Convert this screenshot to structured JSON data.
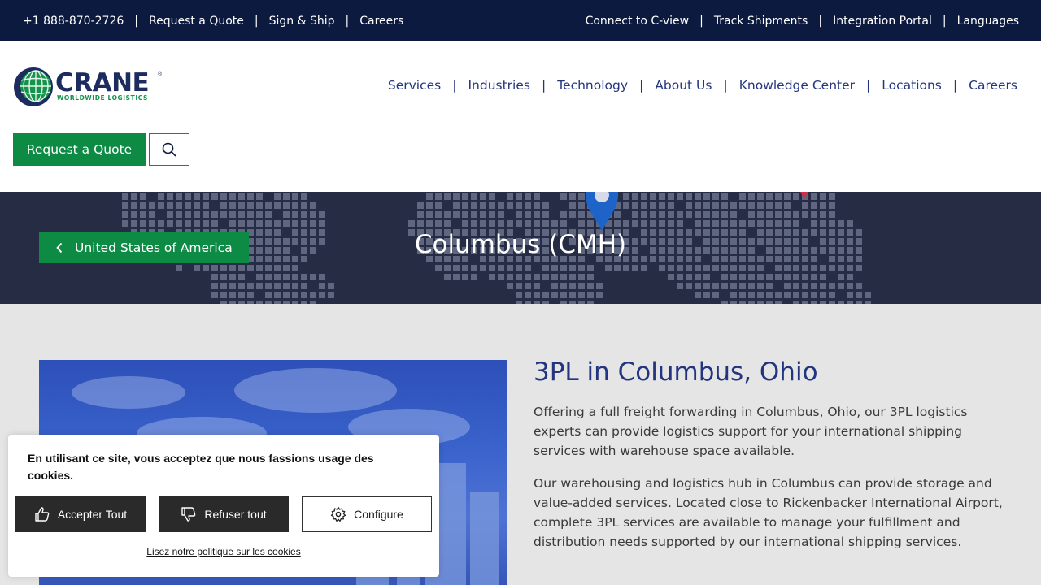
{
  "topbar": {
    "phone": "+1 888-870-2726",
    "request_quote": "Request a Quote",
    "sign_ship": "Sign & Ship",
    "careers": "Careers",
    "connect": "Connect to C-view",
    "track": "Track Shipments",
    "integration": "Integration Portal",
    "languages": "Languages",
    "separator": "|"
  },
  "logo": {
    "name": "CRANE",
    "tagline": "WORLDWIDE LOGISTICS",
    "registered": "®"
  },
  "nav": {
    "services": "Services",
    "industries": "Industries",
    "technology": "Technology",
    "about": "About Us",
    "knowledge": "Knowledge Center",
    "locations": "Locations",
    "careers": "Careers"
  },
  "header": {
    "quote_button": "Request a Quote"
  },
  "hero": {
    "back_label": "United States of America",
    "title": "Columbus (CMH)"
  },
  "content": {
    "heading": "3PL in Columbus, Ohio",
    "paragraph1": "Offering a full freight forwarding in Columbus, Ohio, our 3PL logistics experts can provide logistics support for your international shipping services with warehouse space available.",
    "paragraph2": "Our warehousing and logistics hub in Columbus can provide storage and value-added services. Located close to Rickenbacker International Airport, complete 3PL services are available to manage your fulfillment and distribution needs supported by our international shipping services."
  },
  "cookie": {
    "message": "En utilisant ce site, vous acceptez que nous fassions usage des cookies.",
    "accept": "Accepter Tout",
    "refuse": "Refuser tout",
    "configure": "Configure",
    "policy": "Lisez notre politique sur les cookies"
  },
  "colors": {
    "navy": "#0b1a3e",
    "brand_blue": "#24357f",
    "brand_green": "#0d8a43",
    "hero_bg": "#252c44"
  },
  "icons": {
    "search": "search-icon",
    "chevron": "chevron-left-icon",
    "thumbs_up": "thumbs-up-icon",
    "thumbs_down": "thumbs-down-icon",
    "gear": "gear-icon",
    "globe": "globe-icon",
    "pin": "map-pin-icon"
  }
}
